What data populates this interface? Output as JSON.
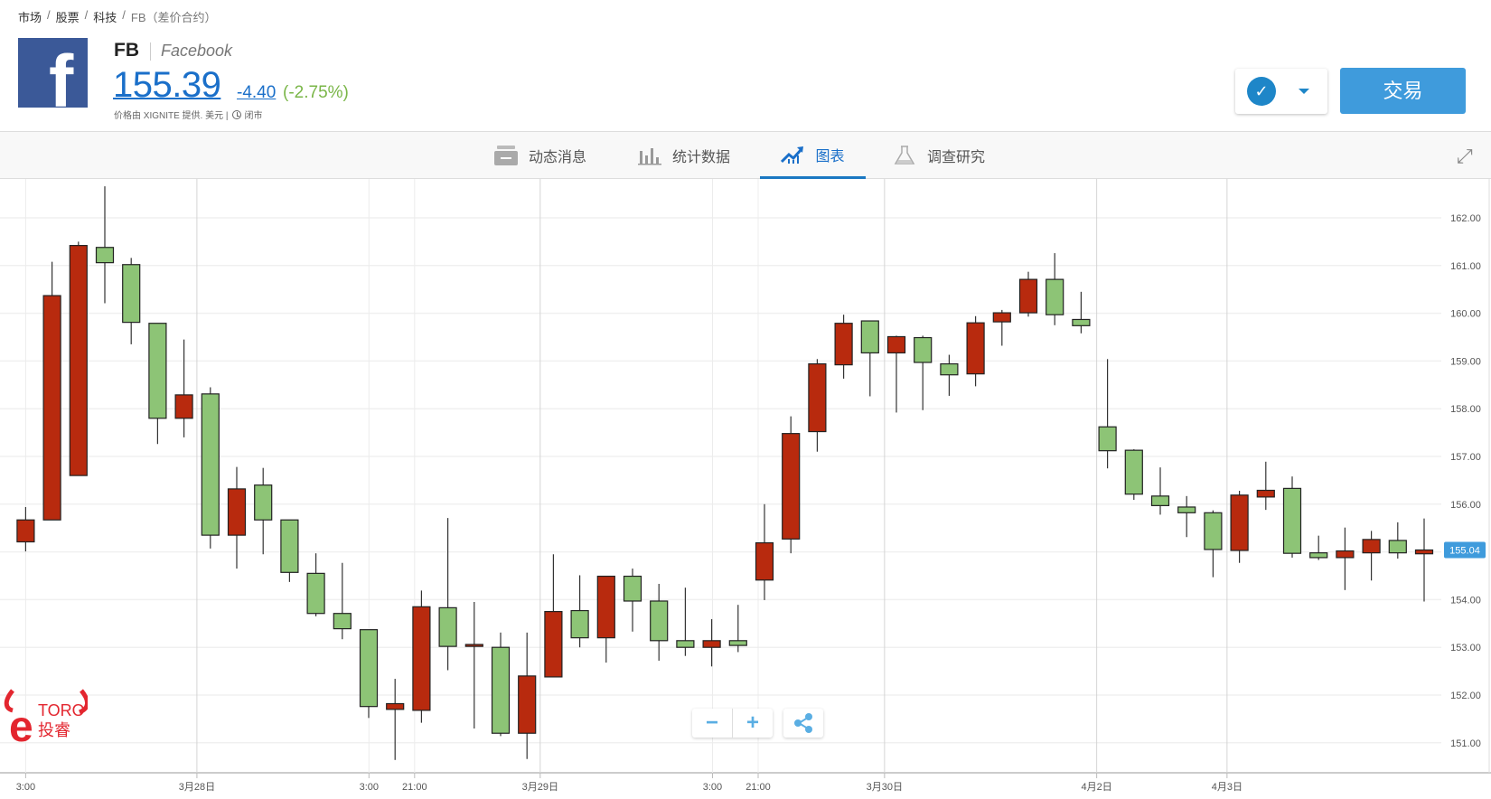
{
  "breadcrumb": [
    "市场",
    "股票",
    "科技",
    "FB（差价合约）"
  ],
  "breadcrumb_separator": "/",
  "instrument": {
    "symbol": "FB",
    "name": "Facebook",
    "price": "155.39",
    "change": "-4.40",
    "change_pct": "(-2.75%)",
    "source": "价格由 XIGNITE 提供. 美元 |",
    "status": "闭市",
    "logo_letter": "f"
  },
  "actions": {
    "trade_label": "交易",
    "watch_icon": "check-icon"
  },
  "tabs": [
    {
      "label": "动态消息",
      "icon": "news-icon"
    },
    {
      "label": "统计数据",
      "icon": "stats-icon"
    },
    {
      "label": "图表",
      "icon": "chart-icon",
      "active": true
    },
    {
      "label": "调查研究",
      "icon": "flask-icon"
    }
  ],
  "zoom": {
    "minus": "−",
    "plus": "+"
  },
  "brand": {
    "logo_text": "eToro 投睿"
  },
  "colors": {
    "up": "#b82a0e",
    "down": "#8dc476",
    "accent": "#3f9bdc",
    "price": "#1a6fc9"
  },
  "chart_data": {
    "type": "candlestick",
    "ylim": [
      150.5,
      162.8
    ],
    "yticks": [
      "151.00",
      "152.00",
      "153.00",
      "154.00",
      "155.00",
      "156.00",
      "157.00",
      "158.00",
      "159.00",
      "160.00",
      "161.00",
      "162.00"
    ],
    "current_price": "155.04",
    "xticks": [
      {
        "label": "3:00",
        "at": 0,
        "major": false
      },
      {
        "label": "3月28日",
        "at": 6.49,
        "major": true
      },
      {
        "label": "3:00",
        "at": 13.01,
        "major": false
      },
      {
        "label": "21:00",
        "at": 14.74,
        "major": false
      },
      {
        "label": "3月29日",
        "at": 19.5,
        "major": true
      },
      {
        "label": "3:00",
        "at": 26.03,
        "major": false
      },
      {
        "label": "21:00",
        "at": 27.76,
        "major": false
      },
      {
        "label": "3月30日",
        "at": 32.55,
        "major": true
      },
      {
        "label": "4月2日",
        "at": 40.59,
        "major": true
      },
      {
        "label": "4月3日",
        "at": 45.53,
        "major": true
      }
    ],
    "ohlc": [
      [
        155.21,
        155.94,
        155.01,
        155.67
      ],
      [
        155.67,
        161.08,
        155.67,
        160.37
      ],
      [
        156.6,
        161.5,
        156.6,
        161.42
      ],
      [
        161.38,
        162.66,
        160.21,
        161.06
      ],
      [
        161.02,
        161.16,
        159.35,
        159.81
      ],
      [
        159.79,
        159.79,
        157.26,
        157.8
      ],
      [
        157.8,
        159.45,
        157.4,
        158.29
      ],
      [
        158.31,
        158.45,
        155.07,
        155.35
      ],
      [
        155.35,
        156.78,
        154.65,
        156.32
      ],
      [
        156.4,
        156.76,
        154.95,
        155.67
      ],
      [
        155.67,
        155.67,
        154.37,
        154.57
      ],
      [
        154.55,
        154.97,
        153.65,
        153.71
      ],
      [
        153.71,
        154.77,
        153.17,
        153.39
      ],
      [
        153.37,
        153.37,
        151.52,
        151.76
      ],
      [
        151.7,
        152.34,
        150.64,
        151.82
      ],
      [
        151.68,
        154.19,
        151.42,
        153.85
      ],
      [
        153.83,
        155.71,
        152.52,
        153.02
      ],
      [
        153.02,
        153.95,
        151.3,
        153.06
      ],
      [
        153.0,
        153.31,
        151.14,
        151.2
      ],
      [
        151.2,
        153.31,
        150.66,
        152.4
      ],
      [
        152.38,
        154.95,
        152.38,
        153.75
      ],
      [
        153.77,
        154.51,
        153.0,
        153.2
      ],
      [
        153.2,
        154.49,
        152.68,
        154.49
      ],
      [
        154.49,
        154.65,
        153.33,
        153.97
      ],
      [
        153.97,
        154.33,
        152.72,
        153.14
      ],
      [
        153.14,
        154.25,
        152.82,
        153.0
      ],
      [
        153.0,
        153.59,
        152.6,
        153.14
      ],
      [
        153.14,
        153.89,
        152.9,
        153.04
      ],
      [
        154.41,
        156.0,
        153.99,
        155.19
      ],
      [
        155.27,
        157.84,
        154.97,
        157.48
      ],
      [
        157.52,
        159.04,
        157.1,
        158.94
      ],
      [
        158.92,
        159.97,
        158.63,
        159.79
      ],
      [
        159.84,
        159.84,
        158.26,
        159.17
      ],
      [
        159.17,
        159.53,
        157.92,
        159.51
      ],
      [
        159.49,
        159.53,
        157.97,
        158.97
      ],
      [
        158.94,
        159.13,
        158.27,
        158.71
      ],
      [
        158.73,
        159.94,
        158.47,
        159.8
      ],
      [
        159.82,
        160.07,
        159.32,
        160.01
      ],
      [
        160.01,
        160.87,
        159.93,
        160.71
      ],
      [
        160.71,
        161.26,
        159.75,
        159.97
      ],
      [
        159.87,
        160.45,
        159.58,
        159.74
      ],
      [
        157.62,
        159.04,
        156.75,
        157.12
      ],
      [
        157.13,
        157.15,
        156.09,
        156.21
      ],
      [
        156.17,
        156.77,
        155.78,
        155.97
      ],
      [
        155.94,
        156.17,
        155.31,
        155.82
      ],
      [
        155.82,
        155.87,
        154.47,
        155.05
      ],
      [
        155.03,
        156.28,
        154.77,
        156.19
      ],
      [
        156.15,
        156.89,
        155.88,
        156.29
      ],
      [
        156.33,
        156.58,
        154.88,
        154.97
      ],
      [
        154.98,
        155.34,
        154.83,
        154.88
      ],
      [
        154.88,
        155.51,
        154.2,
        155.02
      ],
      [
        154.98,
        155.44,
        154.4,
        155.26
      ],
      [
        155.24,
        155.62,
        154.86,
        154.98
      ],
      [
        154.96,
        155.7,
        153.96,
        155.04
      ]
    ]
  }
}
